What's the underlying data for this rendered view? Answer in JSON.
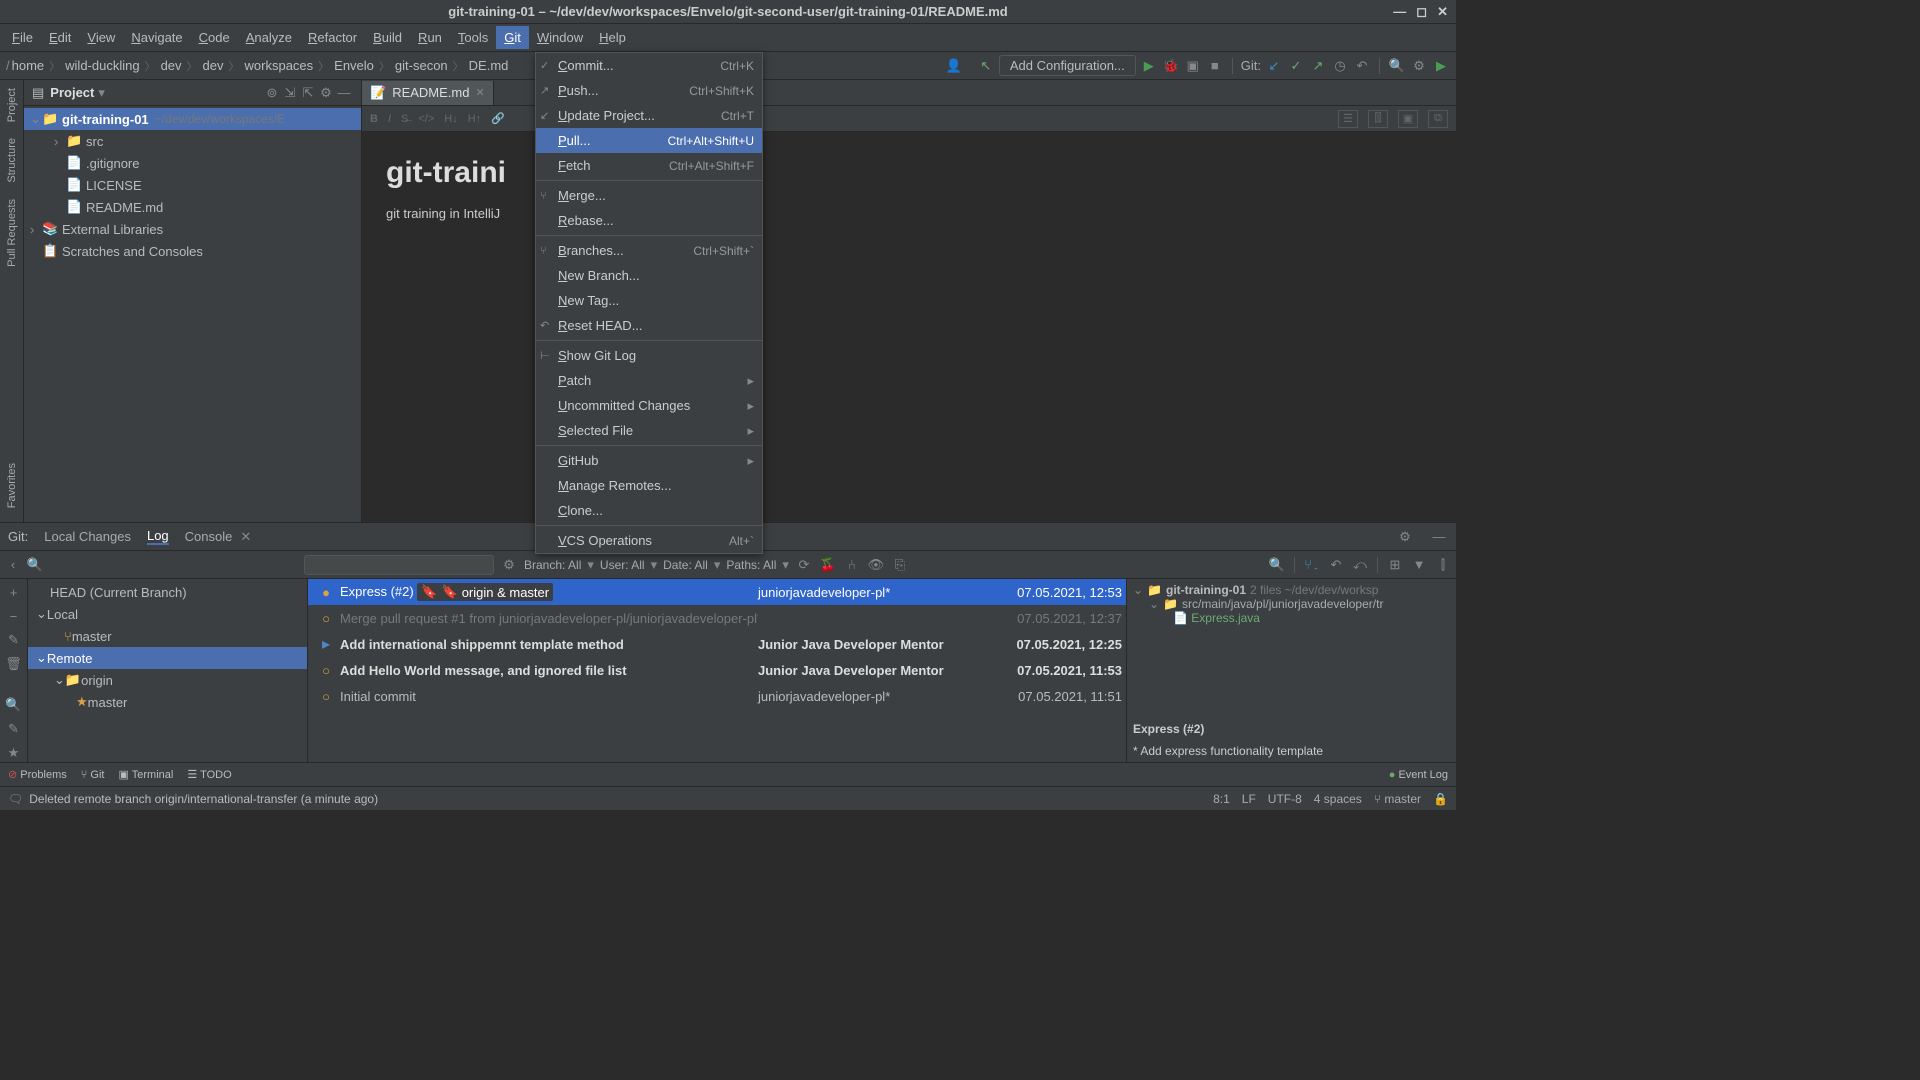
{
  "title": "git-training-01 – ~/dev/dev/workspaces/Envelo/git-second-user/git-training-01/README.md",
  "menu": [
    "File",
    "Edit",
    "View",
    "Navigate",
    "Code",
    "Analyze",
    "Refactor",
    "Build",
    "Run",
    "Tools",
    "Git",
    "Window",
    "Help"
  ],
  "menu_active_index": 10,
  "breadcrumb": [
    "home",
    "wild-duckling",
    "dev",
    "dev",
    "workspaces",
    "Envelo",
    "git-secon",
    "DE.md"
  ],
  "add_config": "Add Configuration...",
  "git_label": "Git:",
  "project": {
    "title": "Project",
    "root": {
      "name": "git-training-01",
      "path": "~/dev/dev/workspaces/E"
    },
    "items": [
      {
        "type": "folder",
        "name": "src",
        "indent": 2
      },
      {
        "type": "file",
        "name": ".gitignore",
        "indent": 3
      },
      {
        "type": "file",
        "name": "LICENSE",
        "indent": 3
      },
      {
        "type": "file",
        "name": "README.md",
        "indent": 3
      }
    ],
    "ext": "External Libraries",
    "scratch": "Scratches and Consoles"
  },
  "tab": "README.md",
  "preview": {
    "h1": "git-traini",
    "p": "git training in IntelliJ"
  },
  "gitmenu": [
    {
      "label": "Commit...",
      "sc": "Ctrl+K",
      "icon": "✓"
    },
    {
      "label": "Push...",
      "sc": "Ctrl+Shift+K",
      "icon": "↗"
    },
    {
      "label": "Update Project...",
      "sc": "Ctrl+T",
      "icon": "↙"
    },
    {
      "label": "Pull...",
      "sc": "Ctrl+Alt+Shift+U",
      "sel": true
    },
    {
      "label": "Fetch",
      "sc": "Ctrl+Alt+Shift+F"
    },
    {
      "sep": true
    },
    {
      "label": "Merge...",
      "icon": "⑂"
    },
    {
      "label": "Rebase..."
    },
    {
      "sep": true
    },
    {
      "label": "Branches...",
      "sc": "Ctrl+Shift+`",
      "icon": "⑂"
    },
    {
      "label": "New Branch..."
    },
    {
      "label": "New Tag..."
    },
    {
      "label": "Reset HEAD...",
      "icon": "↶"
    },
    {
      "sep": true
    },
    {
      "label": "Show Git Log",
      "icon": "⊢"
    },
    {
      "label": "Patch",
      "sub": true
    },
    {
      "label": "Uncommitted Changes",
      "sub": true
    },
    {
      "label": "Selected File",
      "sub": true
    },
    {
      "sep": true
    },
    {
      "label": "GitHub",
      "sub": true
    },
    {
      "label": "Manage Remotes..."
    },
    {
      "label": "Clone..."
    },
    {
      "sep": true
    },
    {
      "label": "VCS Operations",
      "sc": "Alt+`"
    }
  ],
  "bottom": {
    "label": "Git:",
    "tabs": [
      "Local Changes",
      "Log",
      "Console"
    ],
    "active_tab": 1,
    "filters": {
      "branch": "Branch: All",
      "user": "User: All",
      "date": "Date: All",
      "paths": "Paths: All"
    },
    "branch_tree": {
      "head": "HEAD (Current Branch)",
      "local": "Local",
      "local_items": [
        "master"
      ],
      "remote": "Remote",
      "remote_items": [
        {
          "name": "origin",
          "children": [
            "master"
          ]
        }
      ]
    },
    "commits": [
      {
        "msg": "Express (#2)",
        "tags": "origin & master",
        "author": "juniorjavadeveloper-pl*",
        "date": "07.05.2021, 12:53",
        "sel": true
      },
      {
        "msg": "Merge pull request #1 from juniorjavadeveloper-pl/juniorjavadeveloper-pl*",
        "author": "",
        "date": "07.05.2021, 12:37",
        "dim": true
      },
      {
        "msg": "Add international shippemnt template method",
        "author": "Junior Java Developer Mentor",
        "date": "07.05.2021, 12:25",
        "bold": true
      },
      {
        "msg": "Add Hello World message, and ignored file list",
        "author": "Junior Java Developer Mentor",
        "date": "07.05.2021, 11:53",
        "bold": true
      },
      {
        "msg": "Initial commit",
        "author": "juniorjavadeveloper-pl*",
        "date": "07.05.2021, 11:51"
      }
    ],
    "details": {
      "root": "git-training-01",
      "root_info": "2 files  ~/dev/dev/worksp",
      "folder": "src/main/java/pl/juniorjavadeveloper/tr",
      "file": "Express.java",
      "title": "Express (#2)",
      "body": "* Add express functionality template"
    }
  },
  "toolwins": {
    "problems": "Problems",
    "git": "Git",
    "terminal": "Terminal",
    "todo": "TODO",
    "event": "Event Log"
  },
  "statusbar": {
    "left": "Deleted remote branch origin/international-transfer (a minute ago)",
    "pos": "8:1",
    "lf": "LF",
    "enc": "UTF-8",
    "indent": "4 spaces",
    "branch": "master"
  },
  "left_tabs": [
    "Project",
    "Structure",
    "Pull Requests"
  ],
  "left_tabs_bottom": [
    "Favorites"
  ]
}
